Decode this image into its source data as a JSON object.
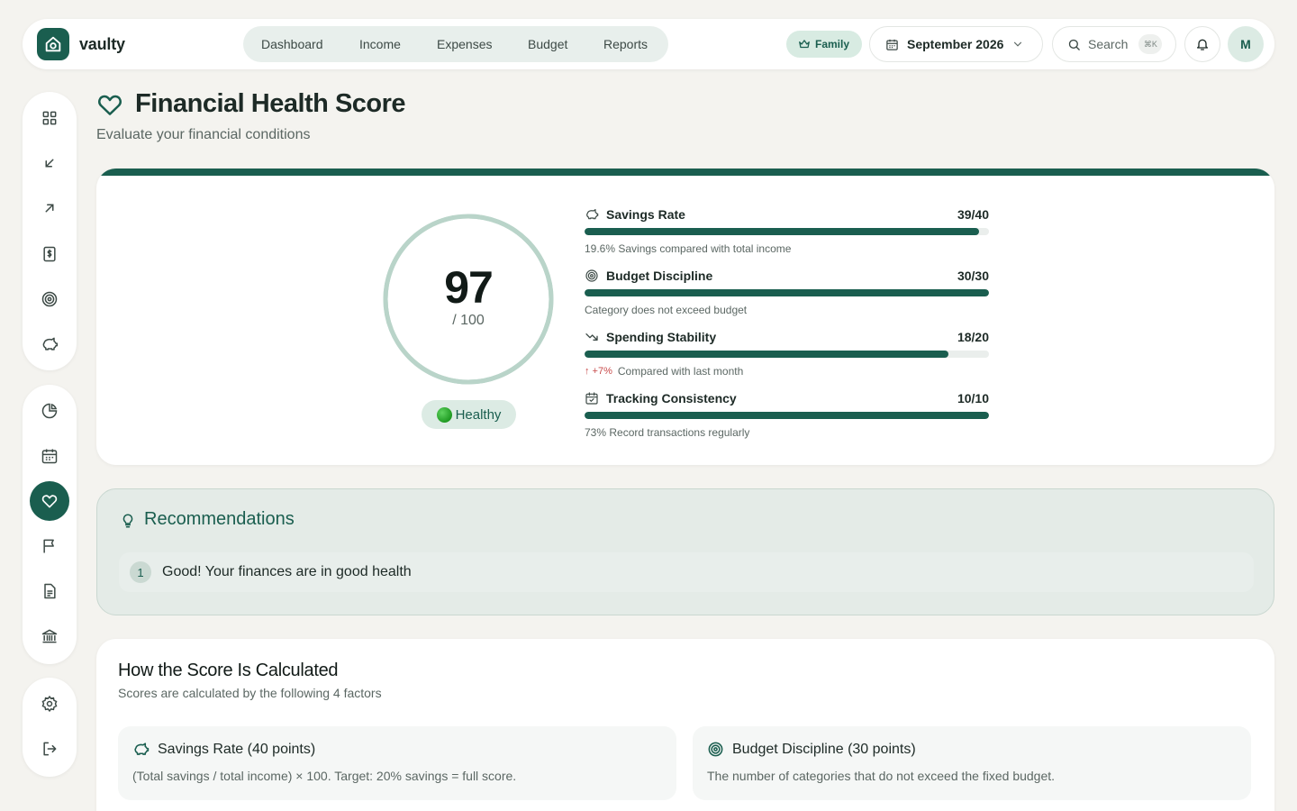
{
  "app": {
    "brand": "vaulty"
  },
  "nav": {
    "items": [
      "Dashboard",
      "Income",
      "Expenses",
      "Budget",
      "Reports"
    ]
  },
  "topbar": {
    "plan_badge": "Family",
    "month": "September 2026",
    "search_label": "Search",
    "search_shortcut": "⌘K",
    "avatar_initial": "M"
  },
  "header": {
    "title": "Financial Health Score",
    "subtitle": "Evaluate your financial conditions"
  },
  "score": {
    "value": "97",
    "max_label": "/ 100",
    "fraction": 0.97,
    "status": "Healthy"
  },
  "factors": [
    {
      "name": "Savings Rate",
      "score": "39/40",
      "fill": 0.975,
      "note": "19.6% Savings compared with total income",
      "icon": "piggy-bank-icon"
    },
    {
      "name": "Budget Discipline",
      "score": "30/30",
      "fill": 1.0,
      "note": "Category does not exceed budget",
      "icon": "target-icon"
    },
    {
      "name": "Spending Stability",
      "score": "18/20",
      "fill": 0.9,
      "trend": "↑ +7%",
      "note": "Compared with last month",
      "icon": "trending-down-icon"
    },
    {
      "name": "Tracking Consistency",
      "score": "10/10",
      "fill": 1.0,
      "note": "73% Record transactions regularly",
      "icon": "calendar-check-icon"
    }
  ],
  "recommendations": {
    "title": "Recommendations",
    "items": [
      {
        "num": "1",
        "text": "Good! Your finances are in good health"
      }
    ]
  },
  "calculation": {
    "title": "How the Score Is Calculated",
    "subtitle": "Scores are calculated by the following 4 factors",
    "tiles": [
      {
        "name": "Savings Rate (40 points)",
        "desc": "(Total savings / total income) × 100. Target: 20% savings = full score."
      },
      {
        "name": "Budget Discipline (30 points)",
        "desc": "The number of categories that do not exceed the fixed budget."
      }
    ]
  },
  "colors": {
    "accent": "#1a5e4f",
    "ring_track": "#b9d4c9",
    "background": "#f4f3ef",
    "healthy_dot": "#1f9a22",
    "trend_up": "#c84b4b"
  }
}
